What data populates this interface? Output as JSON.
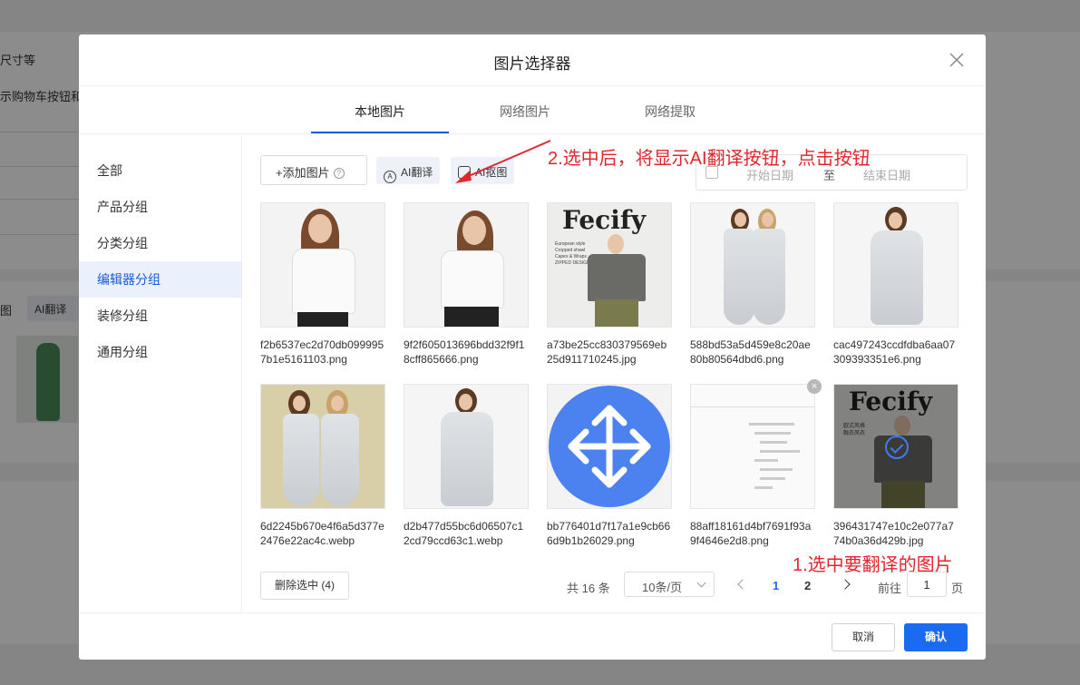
{
  "background": {
    "text_size_hint": "尺寸等",
    "text_cart_button": "示购物车按钮和",
    "text_image": "图",
    "ai_translate_label": "AI翻译"
  },
  "modal": {
    "title": "图片选择器",
    "tabs": [
      {
        "label": "本地图片",
        "active": true
      },
      {
        "label": "网络图片",
        "active": false
      },
      {
        "label": "网络提取",
        "active": false
      }
    ],
    "sidebar": [
      {
        "label": "全部",
        "active": false
      },
      {
        "label": "产品分组",
        "active": false
      },
      {
        "label": "分类分组",
        "active": false
      },
      {
        "label": "编辑器分组",
        "active": true
      },
      {
        "label": "装修分组",
        "active": false
      },
      {
        "label": "通用分组",
        "active": false
      }
    ],
    "toolbar": {
      "add_label": "+添加图片",
      "help_glyph": "?",
      "ai_translate_label": "AI翻译",
      "ai_cutout_label": "AI抠图",
      "start_date_placeholder": "开始日期",
      "date_separator": "至",
      "end_date_placeholder": "结束日期"
    },
    "annotations": {
      "step2": "2.选中后，将显示AI翻译按钮，点击按钮",
      "step1": "1.选中要翻译的图片"
    },
    "images": [
      {
        "name": "f2b6537ec2d70db0999957b1e5161103.png",
        "kind": "model-white-shirt"
      },
      {
        "name": "9f2f605013696bdd32f9f18cff865666.png",
        "kind": "model-white-shirt-2"
      },
      {
        "name": "a73be25cc830379569eb25d911710245.jpg",
        "kind": "fecify-poncho",
        "logo": "Fecify",
        "caption_lines": [
          "European style",
          "Cropped shawl",
          "Capes & Wraps",
          "ZIPPED DESIGN"
        ]
      },
      {
        "name": "588bd53a5d459e8c20ae80b80564dbd6.png",
        "kind": "two-gowns"
      },
      {
        "name": "cac497243ccdfdba6aa07309393351e6.png",
        "kind": "white-gown"
      },
      {
        "name": "6d2245b670e4f6a5d377e2476e22ac4c.webp",
        "kind": "two-gowns-floral"
      },
      {
        "name": "d2b477d55bc6d06507c12cd79ccd63c1.webp",
        "kind": "white-gown-2"
      },
      {
        "name": "bb776401d7f17a1e9cb666d9b1b26029.png",
        "kind": "move-icon"
      },
      {
        "name": "88aff18161d4bf7691f93a9f4646e2d8.png",
        "kind": "code-screenshot",
        "removable": true
      },
      {
        "name": "396431747e10c2e077a774b0a36d429b.jpg",
        "kind": "fecify-poncho-2",
        "selected": true,
        "logo": "Fecify",
        "caption_lines": [
          "欧式风格",
          "融衣风衣"
        ]
      }
    ],
    "remove_glyph": "×",
    "pagination": {
      "delete_selected_label": "删除选中 (4)",
      "total_text": "共 16 条",
      "page_size": "10条/页",
      "pages": [
        "1",
        "2"
      ],
      "current_page": "1",
      "goto_label": "前往",
      "goto_value": "1",
      "goto_suffix": "页"
    },
    "footer": {
      "cancel_label": "取消",
      "confirm_label": "确认"
    }
  },
  "colors": {
    "primary": "#1a6bf0",
    "active_tab": "#1a5bd6",
    "annotation_red": "#e3262e",
    "sidebar_active_bg": "#eaf0fc"
  }
}
